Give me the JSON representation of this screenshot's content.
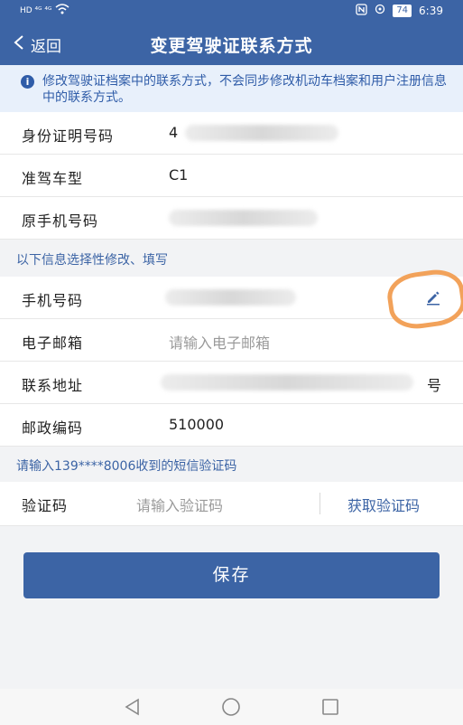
{
  "status_bar": {
    "left_text": "HD ⁴ᴳ ⁴ᴳ",
    "right_icons": [
      "nfc-icon",
      "location-icon"
    ],
    "battery": "74",
    "time": "6:39"
  },
  "header": {
    "back_label": "返回",
    "title": "变更驾驶证联系方式"
  },
  "notice": {
    "text": "修改驾驶证档案中的联系方式，不会同步修改机动车档案和用户注册信息中的联系方式。"
  },
  "fixed_fields": [
    {
      "label": "身份证明号码",
      "value": "4"
    },
    {
      "label": "准驾车型",
      "value": "C1"
    },
    {
      "label": "原手机号码",
      "value": ""
    }
  ],
  "optional_section": {
    "title": "以下信息选择性修改、填写"
  },
  "editable_fields": [
    {
      "label": "手机号码",
      "value": ""
    },
    {
      "label": "电子邮箱",
      "placeholder": "请输入电子邮箱"
    },
    {
      "label": "联系地址",
      "value": "号"
    },
    {
      "label": "邮政编码",
      "value": "510000"
    }
  ],
  "sms_section": {
    "title": "请输入139****8006收到的短信验证码"
  },
  "verification": {
    "label": "验证码",
    "placeholder": "请输入验证码",
    "get_code_label": "获取验证码"
  },
  "actions": {
    "save_label": "保存"
  },
  "colors": {
    "primary": "#3c64a5",
    "notice_bg": "#e8f0fb",
    "highlight": "#f2a25a"
  }
}
